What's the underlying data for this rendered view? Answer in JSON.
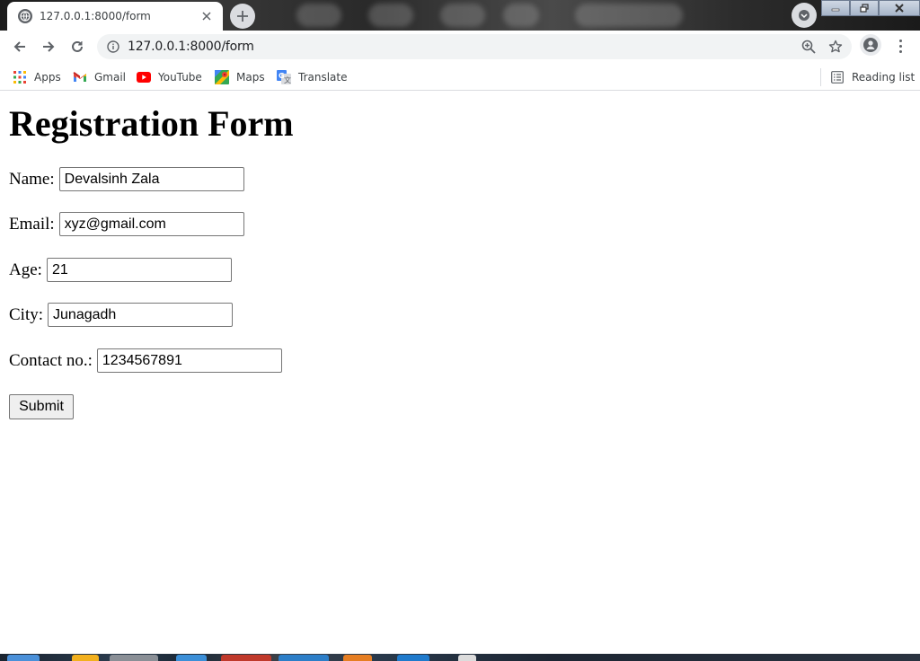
{
  "browser": {
    "tab": {
      "title": "127.0.0.1:8000/form"
    },
    "address_bar": {
      "url": "127.0.0.1:8000/form"
    },
    "bookmarks": [
      {
        "label": "Apps",
        "icon": "apps-grid-icon"
      },
      {
        "label": "Gmail",
        "icon": "gmail-icon"
      },
      {
        "label": "YouTube",
        "icon": "youtube-icon"
      },
      {
        "label": "Maps",
        "icon": "maps-icon"
      },
      {
        "label": "Translate",
        "icon": "translate-icon"
      }
    ],
    "reading_list": {
      "label": "Reading list"
    }
  },
  "form": {
    "heading": "Registration Form",
    "fields": [
      {
        "label": "Name:",
        "value": "Devalsinh Zala"
      },
      {
        "label": "Email:",
        "value": "xyz@gmail.com"
      },
      {
        "label": "Age:",
        "value": "21"
      },
      {
        "label": "City:",
        "value": "Junagadh"
      },
      {
        "label": "Contact no.:",
        "value": "1234567891"
      }
    ],
    "submit_label": "Submit"
  },
  "colors": {
    "accent": "#5f6368",
    "omnibox_bg": "#f1f3f4",
    "youtube_red": "#ff0000"
  }
}
